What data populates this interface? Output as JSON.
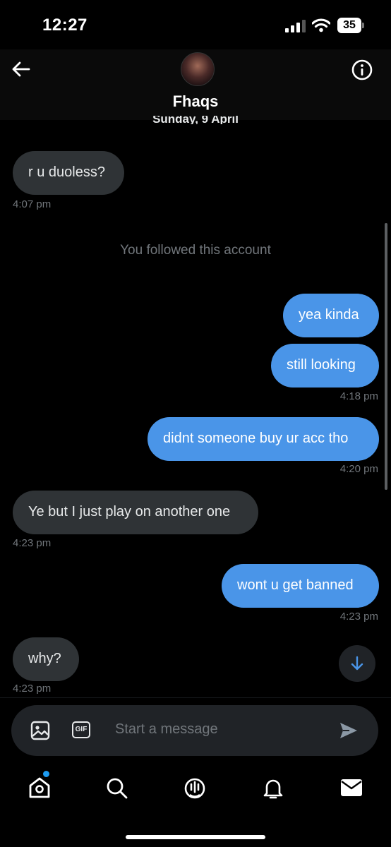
{
  "status_bar": {
    "time": "12:27",
    "battery": "35"
  },
  "header": {
    "name": "Fhaqs",
    "date_divider": "Sunday, 9 April"
  },
  "messages": [
    {
      "dir": "in",
      "text": "r u duoless?",
      "time": "4:07 pm"
    },
    {
      "dir": "system",
      "text": "You followed this account"
    },
    {
      "dir": "out",
      "text": "yea kinda"
    },
    {
      "dir": "out",
      "text": "still looking",
      "time": "4:18 pm"
    },
    {
      "dir": "out",
      "text": "didnt someone buy ur acc tho",
      "time": "4:20 pm"
    },
    {
      "dir": "in",
      "text": "Ye but I just play on another one",
      "time": "4:23 pm"
    },
    {
      "dir": "out",
      "text": "wont u get banned",
      "time": "4:23 pm"
    },
    {
      "dir": "in",
      "text": "why?",
      "time": "4:23 pm"
    }
  ],
  "composer": {
    "placeholder": "Start a message",
    "gif_label": "GIF"
  },
  "colors": {
    "outgoing": "#4a95e8",
    "incoming": "#2f3336",
    "background": "#000000",
    "muted": "#71767b"
  },
  "icons": [
    "back-arrow-icon",
    "info-icon",
    "image-icon",
    "gif-icon",
    "send-icon",
    "scroll-down-icon",
    "home-icon",
    "search-icon",
    "spaces-icon",
    "notifications-icon",
    "messages-icon"
  ]
}
